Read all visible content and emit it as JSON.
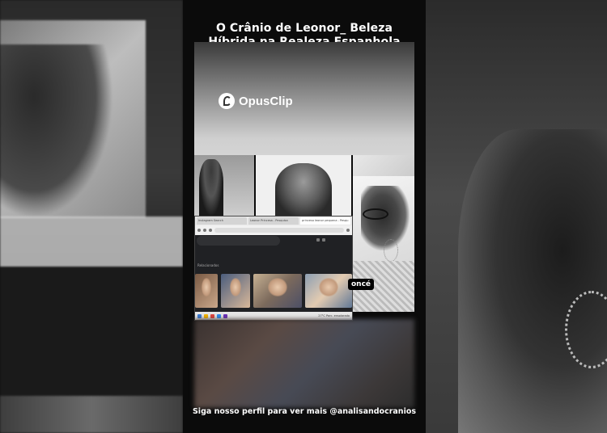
{
  "video": {
    "title_line1": "O Crânio de Leonor_ Beleza",
    "title_line2": "Híbrida na Realeza Espanhola",
    "watermark": "OpusClip",
    "overlay_label": "oncé",
    "footer": "Siga nosso perfil para ver mais @analisandocranios"
  },
  "browser": {
    "tabs": [
      "Instagram Search",
      "Leonor Princesa - Pesquisa",
      "princesa leonor pequena - Pesqu"
    ],
    "sidebar_text": "Relacionados",
    "taskbar_label": "27°C Parc. ensolarado"
  },
  "colors": {
    "background": "#0b0b0b",
    "title": "#ffffff",
    "badge_bg": "#000000"
  }
}
